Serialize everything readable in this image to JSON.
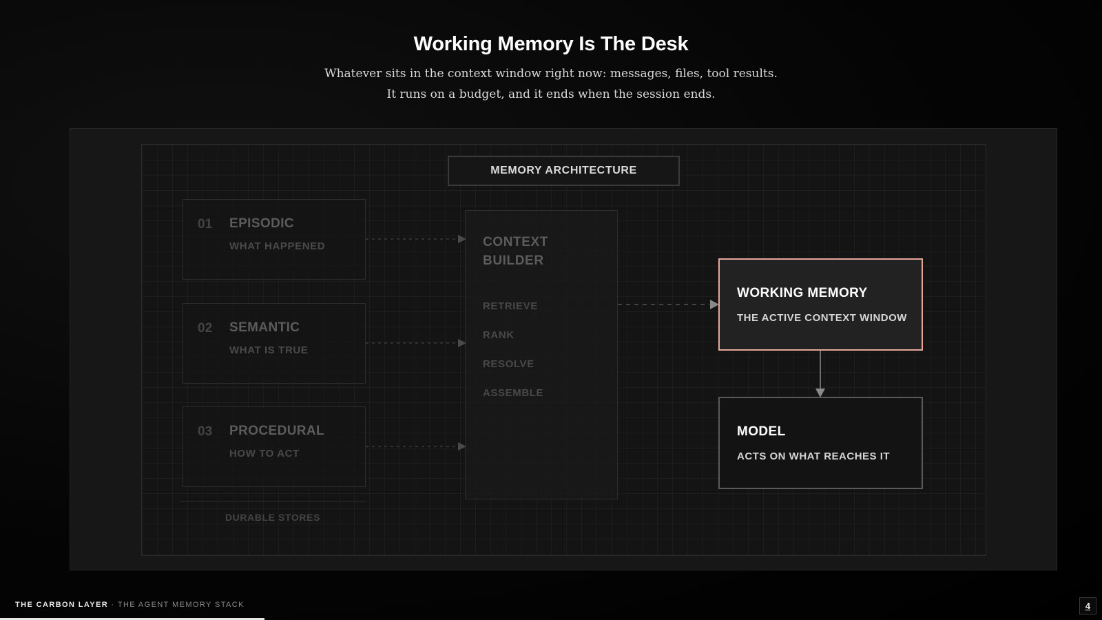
{
  "header": {
    "title": "Working Memory Is The Desk",
    "subtitle_line1": "Whatever sits in the context window right now: messages, files, tool results.",
    "subtitle_line2": "It runs on a budget, and it ends when the session ends."
  },
  "diagram": {
    "heading": "MEMORY ARCHITECTURE",
    "stores": [
      {
        "number": "01",
        "name": "EPISODIC",
        "description": "WHAT HAPPENED"
      },
      {
        "number": "02",
        "name": "SEMANTIC",
        "description": "WHAT IS TRUE"
      },
      {
        "number": "03",
        "name": "PROCEDURAL",
        "description": "HOW TO ACT"
      }
    ],
    "stores_caption": "DURABLE STORES",
    "builder": {
      "title_line1": "CONTEXT",
      "title_line2": "BUILDER",
      "steps": [
        "RETRIEVE",
        "RANK",
        "RESOLVE",
        "ASSEMBLE"
      ]
    },
    "working_memory": {
      "title": "WORKING MEMORY",
      "description": "THE ACTIVE CONTEXT WINDOW"
    },
    "model": {
      "title": "MODEL",
      "description": "ACTS ON WHAT REACHES IT"
    },
    "colors": {
      "highlight_border": "#e6a79b",
      "dim_text": "#5c5c5c",
      "background": "#000000"
    }
  },
  "footer": {
    "brand": "THE CARBON LAYER",
    "separator": " · ",
    "deck_title": "THE AGENT MEMORY STACK",
    "page_number": "4",
    "progress_fraction": 0.24
  }
}
